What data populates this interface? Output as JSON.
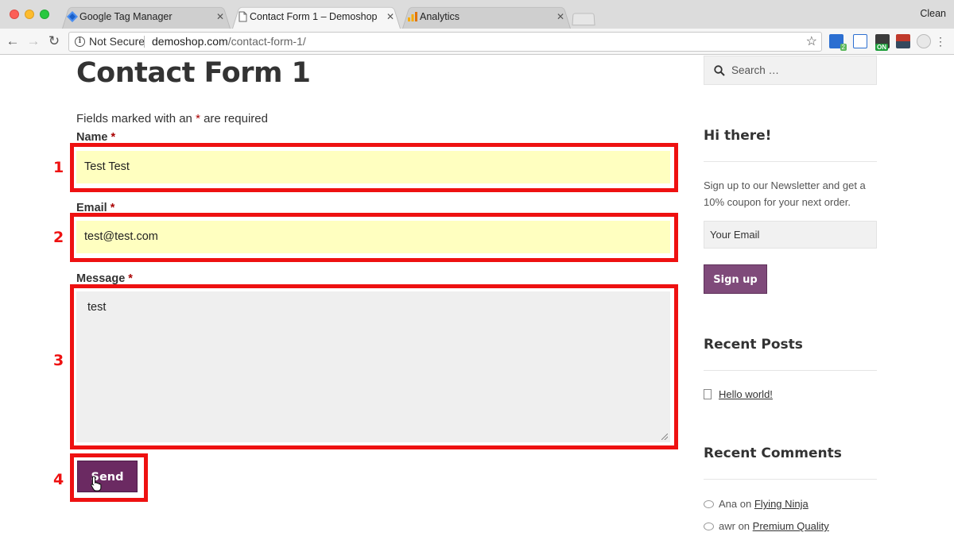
{
  "browser": {
    "profile_label": "Clean",
    "tabs": [
      {
        "label": "Google Tag Manager",
        "close": "✕"
      },
      {
        "label": "Contact Form 1 – Demoshop",
        "close": "✕"
      },
      {
        "label": "Analytics",
        "close": "✕"
      }
    ],
    "security_label": "Not Secure",
    "url_host": "demoshop.com",
    "url_path": "/contact-form-1/",
    "extensions": [
      "tag-assistant-extension",
      "code-extension",
      "on-toggle-extension",
      "flag-extension",
      "ghost-extension"
    ],
    "ext_badge_count": "2",
    "ext_on_label": "ON"
  },
  "page": {
    "title": "Contact Form 1",
    "required_note_pre": "Fields marked with an ",
    "required_note_ast": "*",
    "required_note_post": " are required",
    "fields": {
      "name_label": "Name",
      "name_value": "Test Test",
      "email_label": "Email",
      "email_value": "test@test.com",
      "message_label": "Message",
      "message_value": "test",
      "required_mark": "*"
    },
    "send_label": "Send",
    "steps": [
      "1",
      "2",
      "3",
      "4"
    ]
  },
  "sidebar": {
    "search_placeholder": "Search …",
    "newsletter_title": "Hi there!",
    "newsletter_text": "Sign up to our Newsletter and get a 10% coupon for your next order.",
    "email_placeholder": "Your Email",
    "signup_label": "Sign up",
    "recent_posts_title": "Recent Posts",
    "recent_posts": [
      "Hello world!"
    ],
    "recent_comments_title": "Recent Comments",
    "recent_comments": [
      {
        "author": "Ana",
        "on": "on",
        "post": "Flying Ninja"
      },
      {
        "author": "awr",
        "on": "on",
        "post": "Premium Quality"
      }
    ]
  },
  "colors": {
    "highlight": "#ee1111",
    "button_primary": "#6b2a62",
    "signup_button": "#7f4a7a",
    "input_autofill": "#ffffc0"
  }
}
